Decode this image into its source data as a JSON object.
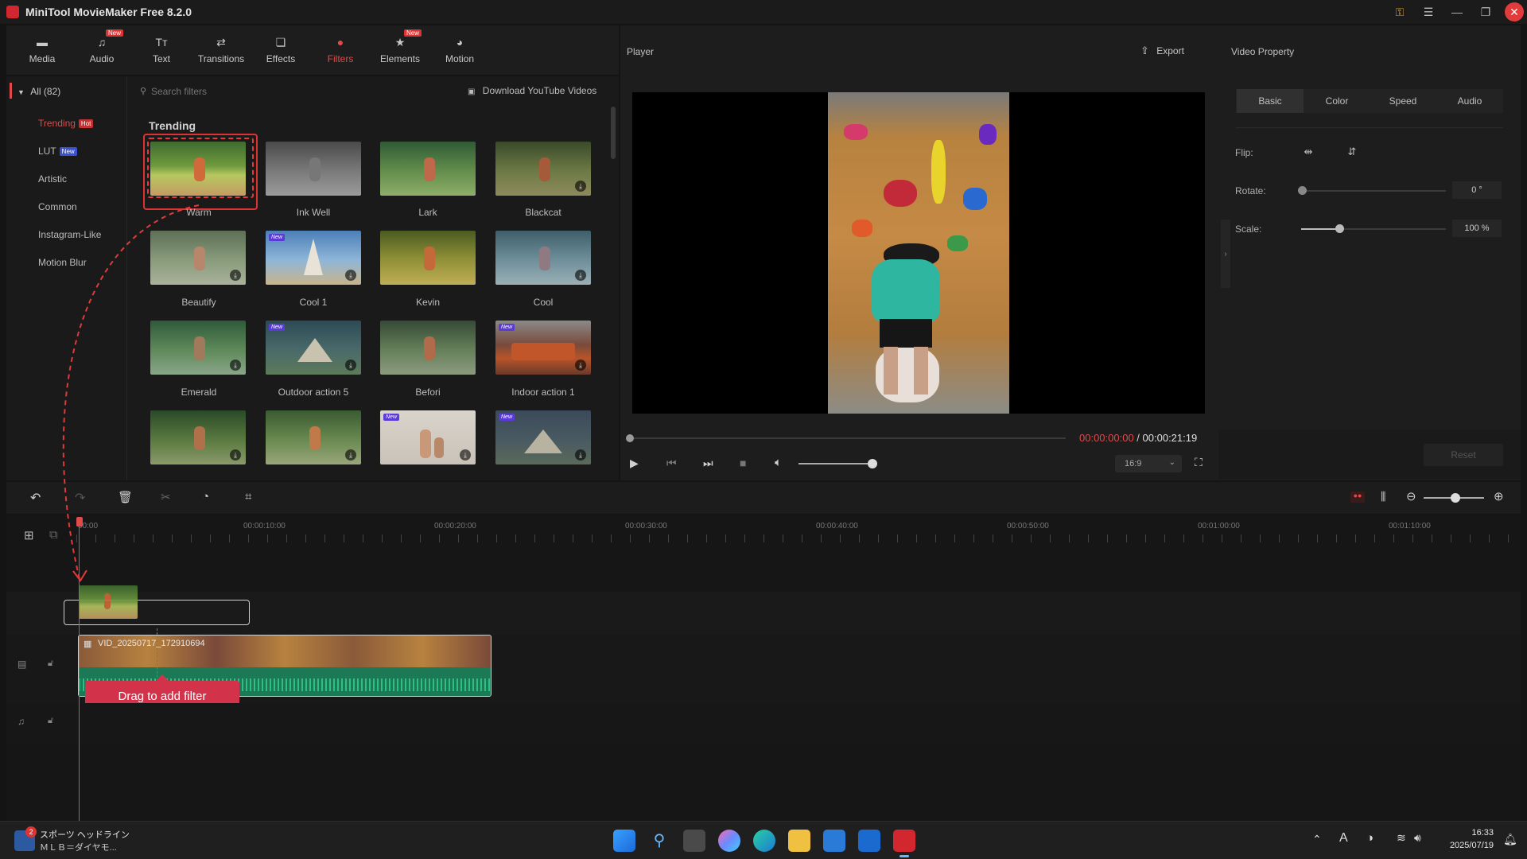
{
  "window": {
    "title": "MiniTool MovieMaker Free 8.2.0"
  },
  "toolbar": {
    "tabs": [
      {
        "label": "Media",
        "icon": "folder-icon",
        "new": ""
      },
      {
        "label": "Audio",
        "icon": "music-icon",
        "new": "New"
      },
      {
        "label": "Text",
        "icon": "text-icon",
        "new": ""
      },
      {
        "label": "Transitions",
        "icon": "transitions-icon",
        "new": ""
      },
      {
        "label": "Effects",
        "icon": "effects-icon",
        "new": ""
      },
      {
        "label": "Filters",
        "icon": "filters-icon",
        "new": ""
      },
      {
        "label": "Elements",
        "icon": "elements-icon",
        "new": "New"
      },
      {
        "label": "Motion",
        "icon": "motion-icon",
        "new": ""
      }
    ],
    "active": "Filters"
  },
  "library": {
    "all_label": "All (82)",
    "categories": [
      {
        "label": "Trending",
        "badge": "Hot"
      },
      {
        "label": "LUT",
        "badge": "New"
      },
      {
        "label": "Artistic",
        "badge": ""
      },
      {
        "label": "Common",
        "badge": ""
      },
      {
        "label": "Instagram-Like",
        "badge": ""
      },
      {
        "label": "Motion Blur",
        "badge": ""
      }
    ],
    "search_placeholder": "Search filters",
    "download_link": "Download YouTube Videos",
    "section_title": "Trending",
    "filters": [
      "Warm",
      "Ink Well",
      "Lark",
      "Blackcat",
      "Beautify",
      "Cool 1",
      "Kevin",
      "Cool",
      "Emerald",
      "Outdoor action 5",
      "Befori",
      "Indoor action 1",
      "",
      "",
      "",
      ""
    ],
    "new_tag": "New"
  },
  "player": {
    "title": "Player",
    "export_label": "Export",
    "time_current": "00:00:00:00",
    "time_separator": " / ",
    "time_total": "00:00:21:19",
    "aspect": "16:9",
    "progress": 0.0,
    "volume": 1.0
  },
  "property": {
    "title": "Video Property",
    "tabs": [
      "Basic",
      "Color",
      "Speed",
      "Audio"
    ],
    "flip_label": "Flip:",
    "rotate_label": "Rotate:",
    "rotate_value": "0 °",
    "rotate_level": 0.0,
    "scale_label": "Scale:",
    "scale_value": "100 %",
    "scale_level": 0.27,
    "reset_label": "Reset"
  },
  "timeline": {
    "ticks": [
      "00:00",
      "00:00:10:00",
      "00:00:20:00",
      "00:00:30:00",
      "00:00:40:00",
      "00:00:50:00",
      "00:01:00:00",
      "00:01:10:00"
    ],
    "clip_name": "VID_20250717_172910694",
    "drag_hint": "Drag to add filter",
    "zoom_level": 0.55
  },
  "taskbar": {
    "news_title": "スポーツ ヘッドライン",
    "news_sub": "ＭＬＢ＝ダイヤモ...",
    "news_count": "2",
    "time": "16:33",
    "date": "2025/07/19",
    "ime": "A"
  },
  "colors": {
    "accent": "#e04a4a",
    "track_green": "#1f8a5a",
    "bg": "#141414"
  }
}
